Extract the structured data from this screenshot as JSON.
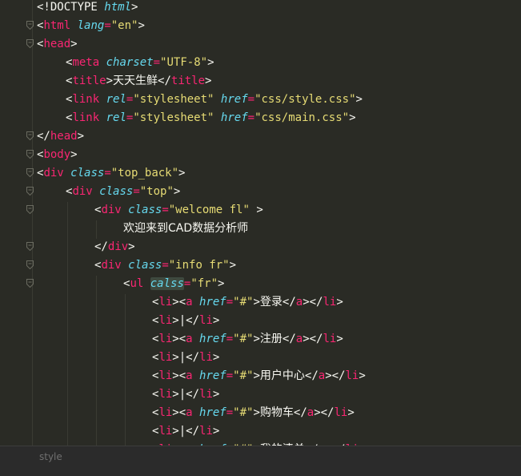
{
  "editor": {
    "lines": [
      {
        "fold": false,
        "tokens": [
          {
            "t": "bracket",
            "v": "<!DOCTYPE "
          },
          {
            "t": "doctype-kw",
            "v": "html"
          },
          {
            "t": "bracket",
            "v": ">"
          }
        ],
        "indent": 46
      },
      {
        "fold": true,
        "tokens": [
          {
            "t": "bracket",
            "v": "<"
          },
          {
            "t": "tag",
            "v": "html "
          },
          {
            "t": "attr",
            "v": "lang"
          },
          {
            "t": "eq",
            "v": "="
          },
          {
            "t": "str",
            "v": "\"en\""
          },
          {
            "t": "bracket",
            "v": ">"
          }
        ],
        "indent": 46
      },
      {
        "fold": true,
        "tokens": [
          {
            "t": "bracket",
            "v": "<"
          },
          {
            "t": "tag",
            "v": "head"
          },
          {
            "t": "bracket",
            "v": ">"
          }
        ],
        "indent": 46
      },
      {
        "fold": false,
        "tokens": [
          {
            "t": "bracket",
            "v": "<"
          },
          {
            "t": "tag",
            "v": "meta "
          },
          {
            "t": "attr",
            "v": "charset"
          },
          {
            "t": "eq",
            "v": "="
          },
          {
            "t": "str",
            "v": "\"UTF-8\""
          },
          {
            "t": "bracket",
            "v": ">"
          }
        ],
        "indent": 82
      },
      {
        "fold": false,
        "tokens": [
          {
            "t": "bracket",
            "v": "<"
          },
          {
            "t": "tag",
            "v": "title"
          },
          {
            "t": "bracket",
            "v": ">"
          },
          {
            "t": "plain",
            "v": "天天生鲜"
          },
          {
            "t": "bracket",
            "v": "</"
          },
          {
            "t": "tag",
            "v": "title"
          },
          {
            "t": "bracket",
            "v": ">"
          }
        ],
        "indent": 82
      },
      {
        "fold": false,
        "tokens": [
          {
            "t": "bracket",
            "v": "<"
          },
          {
            "t": "tag",
            "v": "link "
          },
          {
            "t": "attr",
            "v": "rel"
          },
          {
            "t": "eq",
            "v": "="
          },
          {
            "t": "str",
            "v": "\"stylesheet\" "
          },
          {
            "t": "attr",
            "v": "href"
          },
          {
            "t": "eq",
            "v": "="
          },
          {
            "t": "str",
            "v": "\"css/style.css\""
          },
          {
            "t": "bracket",
            "v": ">"
          }
        ],
        "indent": 82
      },
      {
        "fold": false,
        "tokens": [
          {
            "t": "bracket",
            "v": "<"
          },
          {
            "t": "tag",
            "v": "link "
          },
          {
            "t": "attr",
            "v": "rel"
          },
          {
            "t": "eq",
            "v": "="
          },
          {
            "t": "str",
            "v": "\"stylesheet\" "
          },
          {
            "t": "attr",
            "v": "href"
          },
          {
            "t": "eq",
            "v": "="
          },
          {
            "t": "str",
            "v": "\"css/main.css\""
          },
          {
            "t": "bracket",
            "v": ">"
          }
        ],
        "indent": 82
      },
      {
        "fold": true,
        "tokens": [
          {
            "t": "bracket",
            "v": "</"
          },
          {
            "t": "tag",
            "v": "head"
          },
          {
            "t": "bracket",
            "v": ">"
          }
        ],
        "indent": 46
      },
      {
        "fold": true,
        "tokens": [
          {
            "t": "bracket",
            "v": "<"
          },
          {
            "t": "tag",
            "v": "body"
          },
          {
            "t": "bracket",
            "v": ">"
          }
        ],
        "indent": 46
      },
      {
        "fold": true,
        "tokens": [
          {
            "t": "bracket",
            "v": "<"
          },
          {
            "t": "tag",
            "v": "div "
          },
          {
            "t": "attr",
            "v": "class"
          },
          {
            "t": "eq",
            "v": "="
          },
          {
            "t": "str",
            "v": "\"top_back\""
          },
          {
            "t": "bracket",
            "v": ">"
          }
        ],
        "indent": 46
      },
      {
        "fold": true,
        "tokens": [
          {
            "t": "bracket",
            "v": "<"
          },
          {
            "t": "tag",
            "v": "div "
          },
          {
            "t": "attr",
            "v": "class"
          },
          {
            "t": "eq",
            "v": "="
          },
          {
            "t": "str",
            "v": "\"top\""
          },
          {
            "t": "bracket",
            "v": ">"
          }
        ],
        "indent": 82
      },
      {
        "fold": true,
        "tokens": [
          {
            "t": "bracket",
            "v": "<"
          },
          {
            "t": "tag",
            "v": "div "
          },
          {
            "t": "attr",
            "v": "class"
          },
          {
            "t": "eq",
            "v": "="
          },
          {
            "t": "str",
            "v": "\"welcome fl\" "
          },
          {
            "t": "bracket",
            "v": ">"
          }
        ],
        "indent": 118
      },
      {
        "fold": false,
        "tokens": [
          {
            "t": "plain",
            "v": "欢迎来到CAD数据分析师"
          }
        ],
        "indent": 154
      },
      {
        "fold": true,
        "tokens": [
          {
            "t": "bracket",
            "v": "</"
          },
          {
            "t": "tag",
            "v": "div"
          },
          {
            "t": "bracket",
            "v": ">"
          }
        ],
        "indent": 118
      },
      {
        "fold": true,
        "tokens": [
          {
            "t": "bracket",
            "v": "<"
          },
          {
            "t": "tag",
            "v": "div "
          },
          {
            "t": "attr",
            "v": "class"
          },
          {
            "t": "eq",
            "v": "="
          },
          {
            "t": "str",
            "v": "\"info fr\""
          },
          {
            "t": "bracket",
            "v": ">"
          }
        ],
        "indent": 118
      },
      {
        "fold": true,
        "tokens": [
          {
            "t": "bracket",
            "v": "<"
          },
          {
            "t": "tag",
            "v": "ul "
          },
          {
            "t": "attr-hl",
            "v": "calss"
          },
          {
            "t": "eq",
            "v": "="
          },
          {
            "t": "str",
            "v": "\"fr\""
          },
          {
            "t": "bracket",
            "v": ">"
          }
        ],
        "indent": 154
      },
      {
        "fold": false,
        "tokens": [
          {
            "t": "bracket",
            "v": "<"
          },
          {
            "t": "tag",
            "v": "li"
          },
          {
            "t": "bracket",
            "v": "><"
          },
          {
            "t": "tag",
            "v": "a "
          },
          {
            "t": "attr",
            "v": "href"
          },
          {
            "t": "eq",
            "v": "="
          },
          {
            "t": "str",
            "v": "\"#\""
          },
          {
            "t": "bracket",
            "v": ">"
          },
          {
            "t": "plain",
            "v": "登录"
          },
          {
            "t": "bracket",
            "v": "</"
          },
          {
            "t": "tag",
            "v": "a"
          },
          {
            "t": "bracket",
            "v": "></"
          },
          {
            "t": "tag",
            "v": "li"
          },
          {
            "t": "bracket",
            "v": ">"
          }
        ],
        "indent": 190
      },
      {
        "fold": false,
        "tokens": [
          {
            "t": "bracket",
            "v": "<"
          },
          {
            "t": "tag",
            "v": "li"
          },
          {
            "t": "bracket",
            "v": ">"
          },
          {
            "t": "plain",
            "v": "|"
          },
          {
            "t": "bracket",
            "v": "</"
          },
          {
            "t": "tag",
            "v": "li"
          },
          {
            "t": "bracket",
            "v": ">"
          }
        ],
        "indent": 190
      },
      {
        "fold": false,
        "tokens": [
          {
            "t": "bracket",
            "v": "<"
          },
          {
            "t": "tag",
            "v": "li"
          },
          {
            "t": "bracket",
            "v": "><"
          },
          {
            "t": "tag",
            "v": "a "
          },
          {
            "t": "attr",
            "v": "href"
          },
          {
            "t": "eq",
            "v": "="
          },
          {
            "t": "str",
            "v": "\"#\""
          },
          {
            "t": "bracket",
            "v": ">"
          },
          {
            "t": "plain",
            "v": "注册"
          },
          {
            "t": "bracket",
            "v": "</"
          },
          {
            "t": "tag",
            "v": "a"
          },
          {
            "t": "bracket",
            "v": "></"
          },
          {
            "t": "tag",
            "v": "li"
          },
          {
            "t": "bracket",
            "v": ">"
          }
        ],
        "indent": 190
      },
      {
        "fold": false,
        "tokens": [
          {
            "t": "bracket",
            "v": "<"
          },
          {
            "t": "tag",
            "v": "li"
          },
          {
            "t": "bracket",
            "v": ">"
          },
          {
            "t": "plain",
            "v": "|"
          },
          {
            "t": "bracket",
            "v": "</"
          },
          {
            "t": "tag",
            "v": "li"
          },
          {
            "t": "bracket",
            "v": ">"
          }
        ],
        "indent": 190
      },
      {
        "fold": false,
        "tokens": [
          {
            "t": "bracket",
            "v": "<"
          },
          {
            "t": "tag",
            "v": "li"
          },
          {
            "t": "bracket",
            "v": "><"
          },
          {
            "t": "tag",
            "v": "a "
          },
          {
            "t": "attr",
            "v": "href"
          },
          {
            "t": "eq",
            "v": "="
          },
          {
            "t": "str",
            "v": "\"#\""
          },
          {
            "t": "bracket",
            "v": ">"
          },
          {
            "t": "plain",
            "v": "用户中心"
          },
          {
            "t": "bracket",
            "v": "</"
          },
          {
            "t": "tag",
            "v": "a"
          },
          {
            "t": "bracket",
            "v": "></"
          },
          {
            "t": "tag",
            "v": "li"
          },
          {
            "t": "bracket",
            "v": ">"
          }
        ],
        "indent": 190
      },
      {
        "fold": false,
        "tokens": [
          {
            "t": "bracket",
            "v": "<"
          },
          {
            "t": "tag",
            "v": "li"
          },
          {
            "t": "bracket",
            "v": ">"
          },
          {
            "t": "plain",
            "v": "|"
          },
          {
            "t": "bracket",
            "v": "</"
          },
          {
            "t": "tag",
            "v": "li"
          },
          {
            "t": "bracket",
            "v": ">"
          }
        ],
        "indent": 190
      },
      {
        "fold": false,
        "tokens": [
          {
            "t": "bracket",
            "v": "<"
          },
          {
            "t": "tag",
            "v": "li"
          },
          {
            "t": "bracket",
            "v": "><"
          },
          {
            "t": "tag",
            "v": "a "
          },
          {
            "t": "attr",
            "v": "href"
          },
          {
            "t": "eq",
            "v": "="
          },
          {
            "t": "str",
            "v": "\"#\""
          },
          {
            "t": "bracket",
            "v": ">"
          },
          {
            "t": "plain",
            "v": "购物车"
          },
          {
            "t": "bracket",
            "v": "</"
          },
          {
            "t": "tag",
            "v": "a"
          },
          {
            "t": "bracket",
            "v": "></"
          },
          {
            "t": "tag",
            "v": "li"
          },
          {
            "t": "bracket",
            "v": ">"
          }
        ],
        "indent": 190
      },
      {
        "fold": false,
        "tokens": [
          {
            "t": "bracket",
            "v": "<"
          },
          {
            "t": "tag",
            "v": "li"
          },
          {
            "t": "bracket",
            "v": ">"
          },
          {
            "t": "plain",
            "v": "|"
          },
          {
            "t": "bracket",
            "v": "</"
          },
          {
            "t": "tag",
            "v": "li"
          },
          {
            "t": "bracket",
            "v": ">"
          }
        ],
        "indent": 190
      },
      {
        "fold": false,
        "tokens": [
          {
            "t": "bracket",
            "v": "<"
          },
          {
            "t": "tag",
            "v": "li"
          },
          {
            "t": "bracket",
            "v": "><"
          },
          {
            "t": "tag",
            "v": "a "
          },
          {
            "t": "attr",
            "v": "href"
          },
          {
            "t": "eq",
            "v": "="
          },
          {
            "t": "str",
            "v": "\"#\""
          },
          {
            "t": "bracket",
            "v": ">"
          },
          {
            "t": "plain",
            "v": "我的清单"
          },
          {
            "t": "bracket",
            "v": "</"
          },
          {
            "t": "tag",
            "v": "a"
          },
          {
            "t": "bracket",
            "v": "></"
          },
          {
            "t": "tag",
            "v": "li"
          },
          {
            "t": "bracket",
            "v": ">"
          }
        ],
        "indent": 190
      }
    ]
  },
  "statusbar": {
    "breadcrumb": "style"
  },
  "colors": {
    "background": "#2a2b25",
    "tag": "#f92672",
    "attribute": "#66d9ef",
    "string": "#e6db74",
    "text": "#f8f8f2"
  }
}
